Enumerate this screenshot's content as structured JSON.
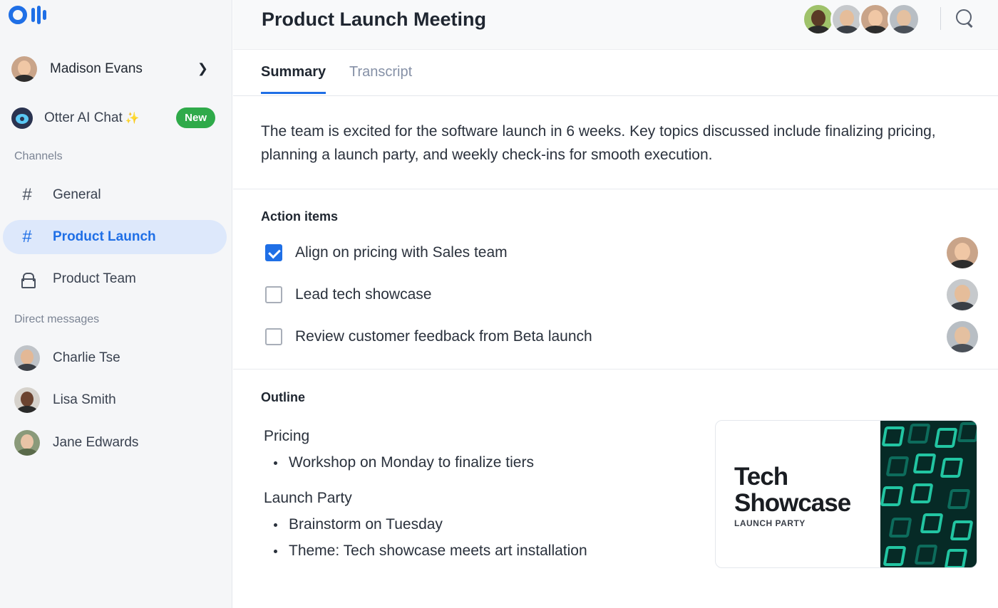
{
  "sidebar": {
    "user": {
      "name": "Madison Evans"
    },
    "otter_chat": {
      "label": "Otter AI Chat",
      "sparkle": "✨",
      "badge": "New"
    },
    "channels_label": "Channels",
    "channels": [
      {
        "label": "General",
        "icon": "hash-icon",
        "active": false
      },
      {
        "label": "Product Launch",
        "icon": "hash-icon",
        "active": true
      },
      {
        "label": "Product Team",
        "icon": "lock-icon",
        "active": false
      }
    ],
    "dm_label": "Direct messages",
    "direct_messages": [
      {
        "label": "Charlie Tse"
      },
      {
        "label": "Lisa Smith"
      },
      {
        "label": "Jane Edwards"
      }
    ]
  },
  "header": {
    "title": "Product Launch Meeting"
  },
  "tabs": [
    {
      "label": "Summary",
      "active": true
    },
    {
      "label": "Transcript",
      "active": false
    }
  ],
  "summary": {
    "text": "The team is excited for the software launch in 6 weeks. Key topics discussed include finalizing pricing, planning a launch party, and weekly check-ins for smooth execution."
  },
  "action_items": {
    "title": "Action items",
    "items": [
      {
        "label": "Align on pricing with Sales team",
        "checked": true
      },
      {
        "label": "Lead tech showcase",
        "checked": false
      },
      {
        "label": "Review customer feedback from Beta launch",
        "checked": false
      }
    ]
  },
  "outline": {
    "title": "Outline",
    "groups": [
      {
        "heading": "Pricing",
        "bullets": [
          "Workshop on Monday to finalize tiers"
        ]
      },
      {
        "heading": "Launch Party",
        "bullets": [
          "Brainstorm on Tuesday",
          "Theme: Tech showcase meets art installation"
        ]
      }
    ]
  },
  "card": {
    "title_line1": "Tech",
    "title_line2": "Showcase",
    "subtitle": "LAUNCH PARTY"
  },
  "colors": {
    "accent": "#1f6fe6",
    "badge_green": "#2faa4a",
    "active_nav_bg": "#dde8fb"
  }
}
